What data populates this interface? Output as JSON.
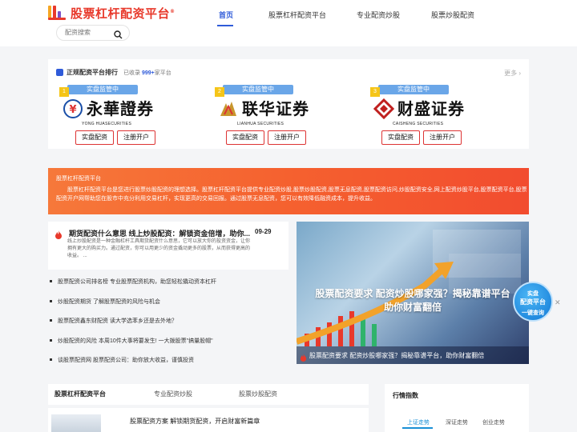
{
  "header": {
    "logo_text": "股票杠杆配资平台",
    "logo_mark": "®",
    "search_placeholder": "配资搜索",
    "nav": [
      "首页",
      "股票杠杆配资平台",
      "专业配资炒股",
      "股票炒股配资"
    ]
  },
  "ranking": {
    "title": "正规配资平台排行",
    "sub_prefix": "已收录",
    "sub_count": "999+",
    "sub_suffix": "家平台",
    "more": "更多",
    "brokers": [
      {
        "num": "1",
        "tag": "实盘监管中",
        "name": "永華證券",
        "en": "YONG HUASECURITIES",
        "btn1": "实盘配资",
        "btn2": "注册开户"
      },
      {
        "num": "2",
        "tag": "实盘监管中",
        "name": "联华证券",
        "en": "LIANHUA SECURITIES",
        "btn1": "实盘配资",
        "btn2": "注册开户"
      },
      {
        "num": "3",
        "tag": "实盘监管中",
        "name": "财盛证券",
        "en": "CAISHENG SECURITIES",
        "btn1": "实盘配资",
        "btn2": "注册开户"
      }
    ]
  },
  "banner": {
    "title": "股票杠杆配资平台",
    "text": "股票杠杆配资平台是您进行股票炒股配资的理想选择。股票杠杆配资平台提供专业配资炒股,股票炒股配资,股票无息配资,股票配资访问,炒股配资安全,网上配资炒股平台,股票配资平台,股票配资开户网帮助您在股市中充分利用交易杠杆，实现更高的交易回报。通过股票无息配资，您可以有效降低融资成本，提升收益。"
  },
  "feature": {
    "title": "期货配资什么意思 线上炒股配资：解锁资金倍增，助你...",
    "date": "09-29",
    "desc": "线上炒股配资是一种金融杠杆工具期货配资什么意思，它可以放大你的投资资金，让你拥有更大的购买力。通过配资，你可以用更少的资金撬动更多的股票，从而获得更高的收益。 ..."
  },
  "news": [
    "股票配资公司排名榜 专业股票配资机构，助您轻松撬动资本杠杆",
    "炒股配资期货 了解股票配资的风险与机会",
    "股票配资鑫东财配资 读大学选苯乡还是去外地？",
    "炒股配资的风险 本周10件大事将要发生! 一大拨股票\"搞量股帽\"",
    "谈股票配资网 股票配资公司：助你放大收益，谨慎投资"
  ],
  "promo": {
    "title_line1": "股票配资要求 配资炒股哪家强？揭秘靠谱平台",
    "title_line2": "助你财富翻倍",
    "caption": "股票配资要求 配资炒股哪家强？揭秘靠谱平台，助你财富翻倍"
  },
  "float_badge": {
    "line1": "实盘",
    "line2": "配资平台",
    "line3": "一键查询"
  },
  "tabs": [
    "股票杠杆配资平台",
    "专业配资炒股",
    "股票炒股配资"
  ],
  "lower_article": "股票配资方案 解锁期货配资，开启财富新篇章",
  "market": {
    "title": "行情指数",
    "tabs": [
      "上证走势",
      "深证走势",
      "创业走势"
    ]
  }
}
